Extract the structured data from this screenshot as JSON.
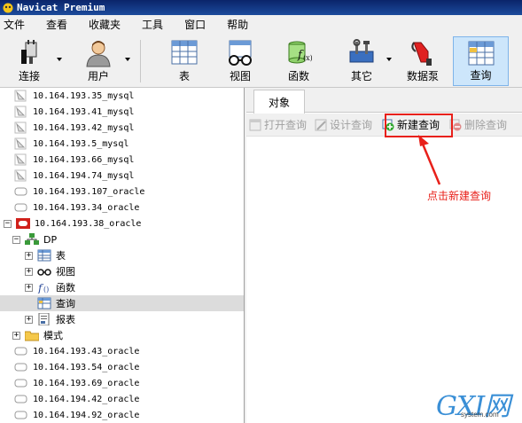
{
  "window": {
    "title": "Navicat Premium"
  },
  "menubar": {
    "items": [
      "文件",
      "查看",
      "收藏夹",
      "工具",
      "窗口",
      "帮助"
    ]
  },
  "toolbar": {
    "connect": "连接",
    "user": "用户",
    "table": "表",
    "view": "视图",
    "function": "函数",
    "other": "其它",
    "datapump": "数据泵",
    "query": "查询"
  },
  "tree": {
    "items": [
      {
        "label": "10.164.193.35_mysql",
        "kind": "mysql"
      },
      {
        "label": "10.164.193.41_mysql",
        "kind": "mysql"
      },
      {
        "label": "10.164.193.42_mysql",
        "kind": "mysql"
      },
      {
        "label": "10.164.193.5_mysql",
        "kind": "mysql"
      },
      {
        "label": "10.164.193.66_mysql",
        "kind": "mysql"
      },
      {
        "label": "10.164.194.74_mysql",
        "kind": "mysql"
      },
      {
        "label": "10.164.193.107_oracle",
        "kind": "oracle"
      },
      {
        "label": "10.164.193.34_oracle",
        "kind": "oracle"
      },
      {
        "label": "10.164.193.38_oracle",
        "kind": "oracle-open"
      },
      {
        "label": "DP",
        "kind": "schema"
      },
      {
        "label": "表",
        "kind": "tables"
      },
      {
        "label": "视图",
        "kind": "views"
      },
      {
        "label": "函数",
        "kind": "functions"
      },
      {
        "label": "查询",
        "kind": "queries"
      },
      {
        "label": "报表",
        "kind": "reports"
      },
      {
        "label": "模式",
        "kind": "schemas"
      },
      {
        "label": "10.164.193.43_oracle",
        "kind": "oracle"
      },
      {
        "label": "10.164.193.54_oracle",
        "kind": "oracle"
      },
      {
        "label": "10.164.193.69_oracle",
        "kind": "oracle"
      },
      {
        "label": "10.164.194.42_oracle",
        "kind": "oracle"
      },
      {
        "label": "10.164.194.92_oracle",
        "kind": "oracle"
      }
    ]
  },
  "objects_tab": {
    "label": "对象"
  },
  "object_toolbar": {
    "open_query": "打开查询",
    "design_query": "设计查询",
    "new_query": "新建查询",
    "delete_query": "删除查询"
  },
  "annotation": {
    "text": "点击新建查询"
  },
  "watermark": {
    "brand": "GXI网",
    "site": "system.com"
  },
  "colors": {
    "highlight": "#e8201a",
    "oracle": "#d0201a",
    "selection": "#cde6fb"
  }
}
